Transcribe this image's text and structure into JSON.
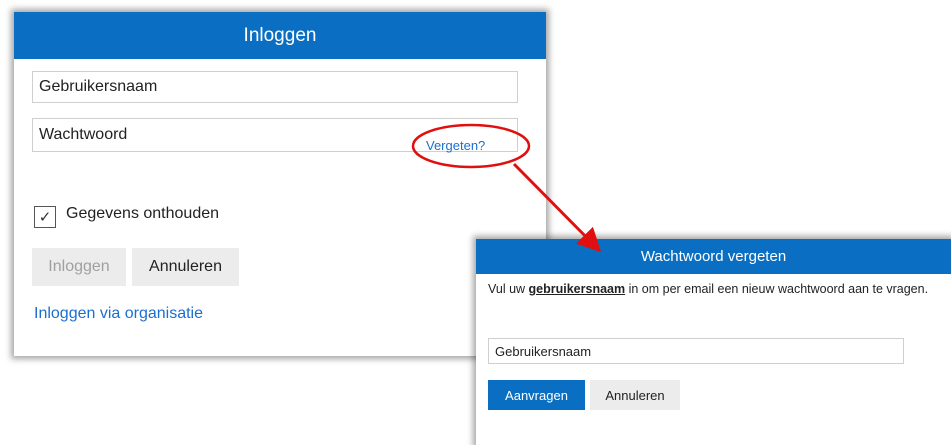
{
  "login": {
    "title": "Inloggen",
    "username_placeholder": "Gebruikersnaam",
    "password_placeholder": "Wachtwoord",
    "forgot_link": "Vergeten?",
    "remember_checked": true,
    "remember_check_glyph": "✓",
    "remember_label": "Gegevens onthouden",
    "login_button": "Inloggen",
    "cancel_button": "Annuleren",
    "org_login_link": "Inloggen via organisatie"
  },
  "forgot_dialog": {
    "title": "Wachtwoord vergeten",
    "description_before": "Vul uw ",
    "description_bold": "gebruikersnaam",
    "description_after": " in om per email een nieuw wachtwoord aan te vragen.",
    "username_placeholder": "Gebruikersnaam",
    "request_button": "Aanvragen",
    "cancel_button": "Annuleren"
  },
  "colors": {
    "header_blue": "#0a6fc2",
    "link_blue": "#1a6fcf",
    "annotation_red": "#e01010"
  },
  "icons": {
    "checkbox": "check-icon",
    "annotation": "red-arrow-icon"
  }
}
